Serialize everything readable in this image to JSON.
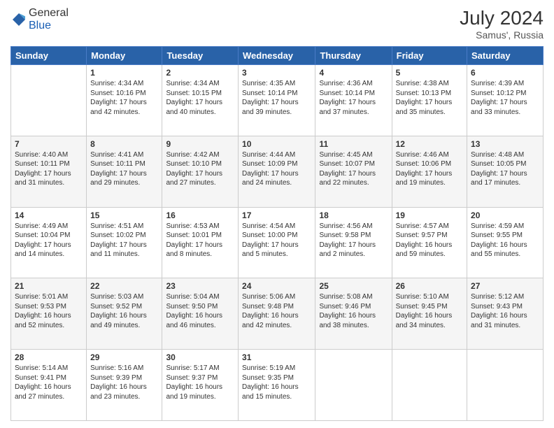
{
  "header": {
    "logo": {
      "general": "General",
      "blue": "Blue"
    },
    "title": "July 2024",
    "location": "Samus', Russia"
  },
  "weekdays": [
    "Sunday",
    "Monday",
    "Tuesday",
    "Wednesday",
    "Thursday",
    "Friday",
    "Saturday"
  ],
  "weeks": [
    [
      {
        "day": "",
        "content": ""
      },
      {
        "day": "1",
        "content": "Sunrise: 4:34 AM\nSunset: 10:16 PM\nDaylight: 17 hours\nand 42 minutes."
      },
      {
        "day": "2",
        "content": "Sunrise: 4:34 AM\nSunset: 10:15 PM\nDaylight: 17 hours\nand 40 minutes."
      },
      {
        "day": "3",
        "content": "Sunrise: 4:35 AM\nSunset: 10:14 PM\nDaylight: 17 hours\nand 39 minutes."
      },
      {
        "day": "4",
        "content": "Sunrise: 4:36 AM\nSunset: 10:14 PM\nDaylight: 17 hours\nand 37 minutes."
      },
      {
        "day": "5",
        "content": "Sunrise: 4:38 AM\nSunset: 10:13 PM\nDaylight: 17 hours\nand 35 minutes."
      },
      {
        "day": "6",
        "content": "Sunrise: 4:39 AM\nSunset: 10:12 PM\nDaylight: 17 hours\nand 33 minutes."
      }
    ],
    [
      {
        "day": "7",
        "content": "Sunrise: 4:40 AM\nSunset: 10:11 PM\nDaylight: 17 hours\nand 31 minutes."
      },
      {
        "day": "8",
        "content": "Sunrise: 4:41 AM\nSunset: 10:11 PM\nDaylight: 17 hours\nand 29 minutes."
      },
      {
        "day": "9",
        "content": "Sunrise: 4:42 AM\nSunset: 10:10 PM\nDaylight: 17 hours\nand 27 minutes."
      },
      {
        "day": "10",
        "content": "Sunrise: 4:44 AM\nSunset: 10:09 PM\nDaylight: 17 hours\nand 24 minutes."
      },
      {
        "day": "11",
        "content": "Sunrise: 4:45 AM\nSunset: 10:07 PM\nDaylight: 17 hours\nand 22 minutes."
      },
      {
        "day": "12",
        "content": "Sunrise: 4:46 AM\nSunset: 10:06 PM\nDaylight: 17 hours\nand 19 minutes."
      },
      {
        "day": "13",
        "content": "Sunrise: 4:48 AM\nSunset: 10:05 PM\nDaylight: 17 hours\nand 17 minutes."
      }
    ],
    [
      {
        "day": "14",
        "content": "Sunrise: 4:49 AM\nSunset: 10:04 PM\nDaylight: 17 hours\nand 14 minutes."
      },
      {
        "day": "15",
        "content": "Sunrise: 4:51 AM\nSunset: 10:02 PM\nDaylight: 17 hours\nand 11 minutes."
      },
      {
        "day": "16",
        "content": "Sunrise: 4:53 AM\nSunset: 10:01 PM\nDaylight: 17 hours\nand 8 minutes."
      },
      {
        "day": "17",
        "content": "Sunrise: 4:54 AM\nSunset: 10:00 PM\nDaylight: 17 hours\nand 5 minutes."
      },
      {
        "day": "18",
        "content": "Sunrise: 4:56 AM\nSunset: 9:58 PM\nDaylight: 17 hours\nand 2 minutes."
      },
      {
        "day": "19",
        "content": "Sunrise: 4:57 AM\nSunset: 9:57 PM\nDaylight: 16 hours\nand 59 minutes."
      },
      {
        "day": "20",
        "content": "Sunrise: 4:59 AM\nSunset: 9:55 PM\nDaylight: 16 hours\nand 55 minutes."
      }
    ],
    [
      {
        "day": "21",
        "content": "Sunrise: 5:01 AM\nSunset: 9:53 PM\nDaylight: 16 hours\nand 52 minutes."
      },
      {
        "day": "22",
        "content": "Sunrise: 5:03 AM\nSunset: 9:52 PM\nDaylight: 16 hours\nand 49 minutes."
      },
      {
        "day": "23",
        "content": "Sunrise: 5:04 AM\nSunset: 9:50 PM\nDaylight: 16 hours\nand 46 minutes."
      },
      {
        "day": "24",
        "content": "Sunrise: 5:06 AM\nSunset: 9:48 PM\nDaylight: 16 hours\nand 42 minutes."
      },
      {
        "day": "25",
        "content": "Sunrise: 5:08 AM\nSunset: 9:46 PM\nDaylight: 16 hours\nand 38 minutes."
      },
      {
        "day": "26",
        "content": "Sunrise: 5:10 AM\nSunset: 9:45 PM\nDaylight: 16 hours\nand 34 minutes."
      },
      {
        "day": "27",
        "content": "Sunrise: 5:12 AM\nSunset: 9:43 PM\nDaylight: 16 hours\nand 31 minutes."
      }
    ],
    [
      {
        "day": "28",
        "content": "Sunrise: 5:14 AM\nSunset: 9:41 PM\nDaylight: 16 hours\nand 27 minutes."
      },
      {
        "day": "29",
        "content": "Sunrise: 5:16 AM\nSunset: 9:39 PM\nDaylight: 16 hours\nand 23 minutes."
      },
      {
        "day": "30",
        "content": "Sunrise: 5:17 AM\nSunset: 9:37 PM\nDaylight: 16 hours\nand 19 minutes."
      },
      {
        "day": "31",
        "content": "Sunrise: 5:19 AM\nSunset: 9:35 PM\nDaylight: 16 hours\nand 15 minutes."
      },
      {
        "day": "",
        "content": ""
      },
      {
        "day": "",
        "content": ""
      },
      {
        "day": "",
        "content": ""
      }
    ]
  ]
}
